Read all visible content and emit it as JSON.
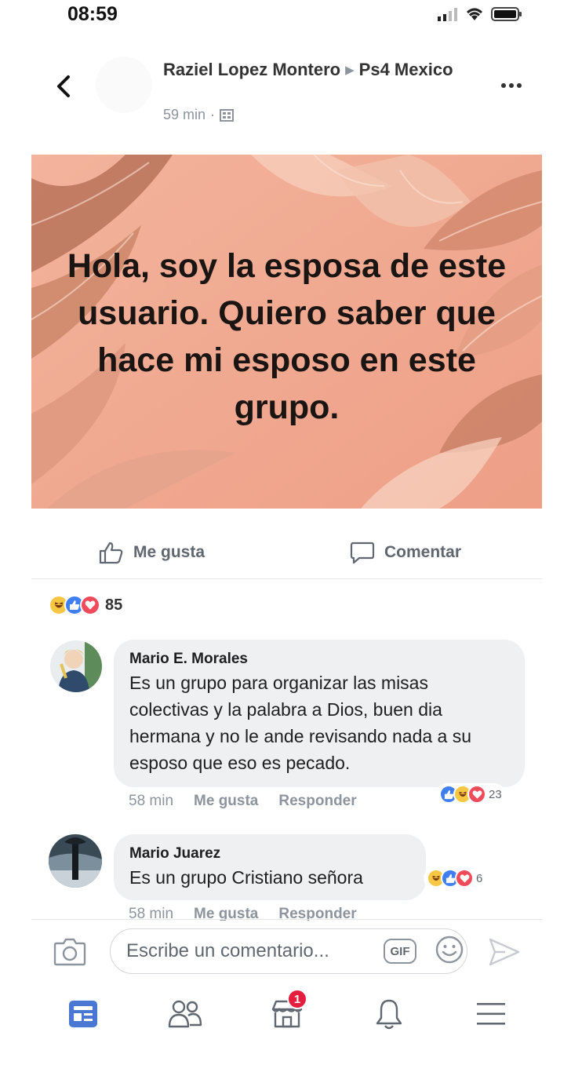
{
  "status_bar": {
    "time": "08:59"
  },
  "post": {
    "author": "Raziel Lopez Montero",
    "group": "Ps4 Mexico",
    "time": "59 min",
    "image_text": "Hola, soy la esposa de este usuario. Quiero saber que hace mi esposo en este grupo.",
    "actions": {
      "like": "Me gusta",
      "comment": "Comentar"
    },
    "reaction_count": "85"
  },
  "comments": [
    {
      "name": "Mario E. Morales",
      "text": "Es un grupo para organizar las misas colectivas y la palabra a Dios, buen dia hermana y no le ande revisando nada a su esposo que eso es pecado.",
      "time": "58 min",
      "like": "Me gusta",
      "reply": "Responder",
      "reaction_count": "23"
    },
    {
      "name": "Mario Juarez",
      "text": "Es un grupo Cristiano señora",
      "time": "58 min",
      "like": "Me gusta",
      "reply": "Responder",
      "reaction_count": "6"
    }
  ],
  "composer": {
    "placeholder": "Escribe un comentario...",
    "gif": "GIF"
  },
  "nav": {
    "marketplace_badge": "1"
  },
  "icons": [
    "back-icon",
    "more-icon",
    "privacy-icon",
    "like-icon",
    "comment-icon",
    "camera-icon",
    "gif-icon",
    "emoji-icon",
    "send-icon",
    "news-feed-icon",
    "friends-icon",
    "marketplace-icon",
    "notifications-icon",
    "menu-icon"
  ],
  "colors": {
    "accent": "#4a76d4",
    "badge": "#e41e3f",
    "bubble": "#eff0f2",
    "post_image_bg": "#f0a890"
  }
}
